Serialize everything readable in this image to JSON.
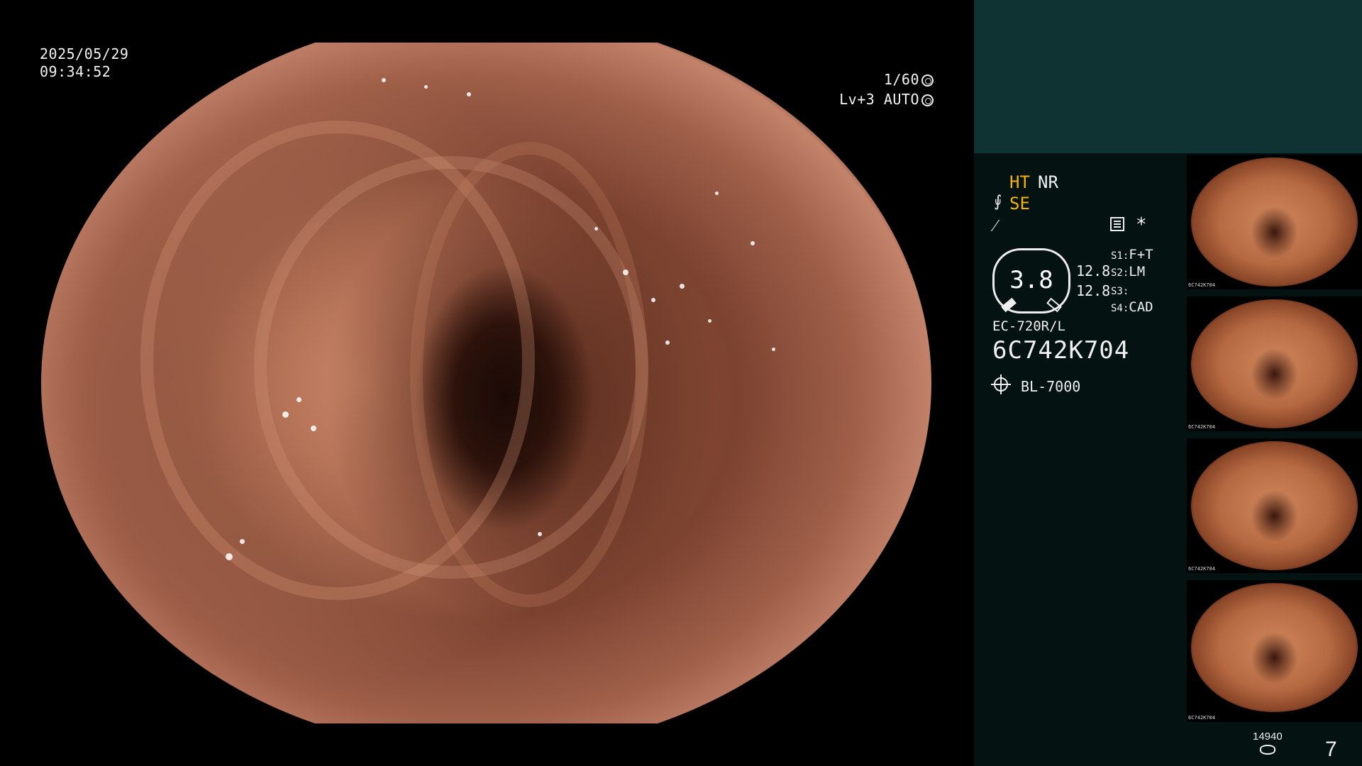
{
  "overlay": {
    "date": "2025/05/29",
    "time": "09:34:52",
    "shutter": "1/60",
    "shutter_icon": "aperture-icon",
    "level": "Lv+3 AUTO",
    "level_icon": "iris-icon"
  },
  "panel": {
    "ht": "HT",
    "nr": "NR",
    "se": "SE",
    "enhance_icon": "structure-enhance-icon",
    "color_icon": "color-mode-icon",
    "memo_icon": "memo-icon",
    "asterisk": "*",
    "gauge_value": "3.8",
    "value1": "12.8",
    "value2": "12.8",
    "switches": [
      {
        "key": "S1",
        "value": "F+T"
      },
      {
        "key": "S2",
        "value": "LM"
      },
      {
        "key": "S3",
        "value": ""
      },
      {
        "key": "S4",
        "value": "CAD"
      }
    ],
    "scope_model": "EC-720R/L",
    "scope_serial": "6C742K704",
    "light_icon": "light-source-icon",
    "light_source": "BL-7000",
    "thumb_caption": "6C742K704",
    "image_count": "14940",
    "storage_icon": "storage-disk-icon",
    "page_number": "7"
  },
  "colors": {
    "panel_bg": "#051212",
    "panel_top_bg": "#0f3333",
    "highlight": "#f4b400"
  }
}
